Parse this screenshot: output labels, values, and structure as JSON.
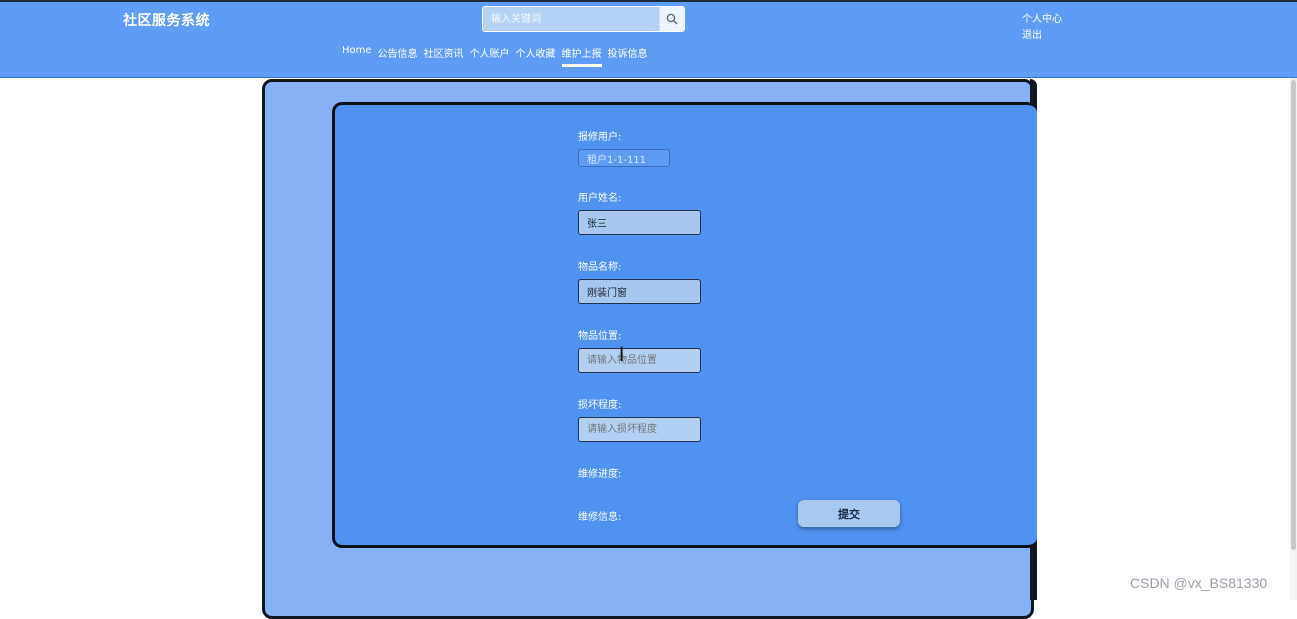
{
  "header": {
    "logo": "社区服务系统",
    "search_placeholder": "输入关键词",
    "user_center": "个人中心",
    "logout": "退出",
    "nav": [
      "Home",
      "公告信息",
      "社区资讯",
      "个人账户",
      "个人收藏",
      "维护上报",
      "投诉信息"
    ],
    "active_nav_index": 5
  },
  "form": {
    "fields": [
      {
        "label": "报修用户:",
        "value": "租户1-1-111",
        "placeholder": ""
      },
      {
        "label": "用户姓名:",
        "value": "张三",
        "placeholder": ""
      },
      {
        "label": "物品名称:",
        "value": "刚装门窗",
        "placeholder": ""
      },
      {
        "label": "物品位置:",
        "value": "",
        "placeholder": "请输入物品位置"
      },
      {
        "label": "损坏程度:",
        "value": "",
        "placeholder": "请输入损坏程度"
      }
    ],
    "progress_label": "维修进度:",
    "info_label": "维修信息:",
    "submit_label": "提交"
  },
  "watermark": "CSDN @vx_BS81330"
}
